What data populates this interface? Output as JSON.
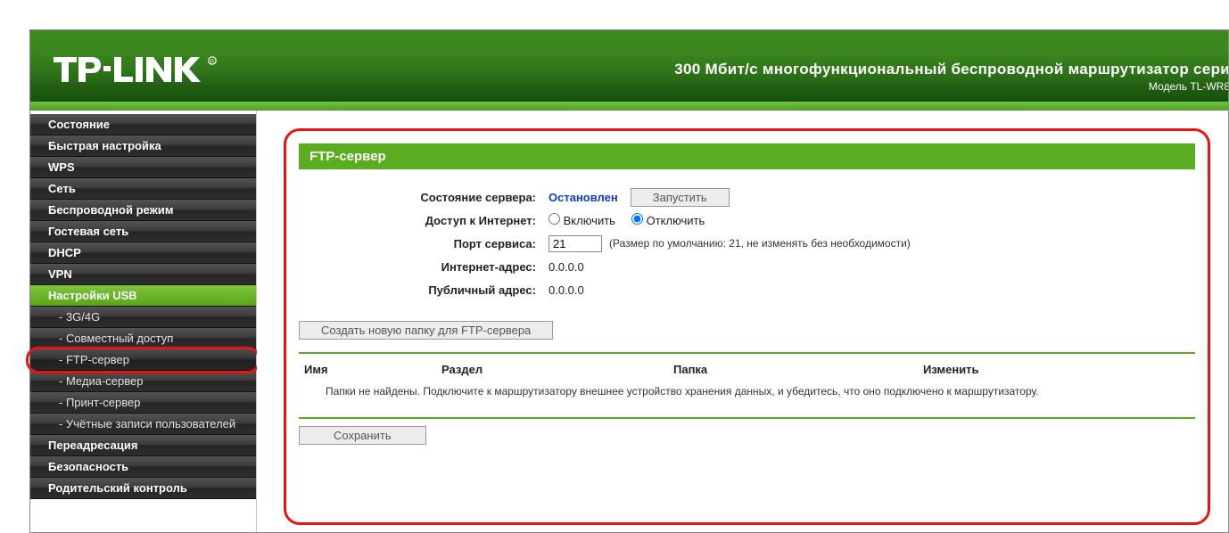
{
  "header": {
    "title": "300 Мбит/с многофункциональный беспроводной маршрутизатор сери",
    "subtitle": "Модель TL-WR8"
  },
  "sidebar": {
    "items": [
      {
        "label": "Состояние",
        "type": "top"
      },
      {
        "label": "Быстрая настройка",
        "type": "top"
      },
      {
        "label": "WPS",
        "type": "top"
      },
      {
        "label": "Сеть",
        "type": "top"
      },
      {
        "label": "Беспроводной режим",
        "type": "top"
      },
      {
        "label": "Гостевая сеть",
        "type": "top"
      },
      {
        "label": "DHCP",
        "type": "top"
      },
      {
        "label": "VPN",
        "type": "top"
      },
      {
        "label": "Настройки USB",
        "type": "top",
        "activeGroup": true
      },
      {
        "label": "- 3G/4G",
        "type": "sub"
      },
      {
        "label": "- Совместный доступ",
        "type": "sub"
      },
      {
        "label": "- FTP-сервер",
        "type": "sub",
        "activeSub": true,
        "highlight": true
      },
      {
        "label": "- Медиа-сервер",
        "type": "sub"
      },
      {
        "label": "- Принт-сервер",
        "type": "sub"
      },
      {
        "label": "- Учётные записи пользователей",
        "type": "sub"
      },
      {
        "label": "Переадресация",
        "type": "top"
      },
      {
        "label": "Безопасность",
        "type": "top"
      },
      {
        "label": "Родительский контроль",
        "type": "top"
      }
    ]
  },
  "panel": {
    "title": "FTP-сервер"
  },
  "form": {
    "server_status_label": "Состояние сервера:",
    "server_status_value": "Остановлен",
    "start_button": "Запустить",
    "internet_access_label": "Доступ к Интернет:",
    "radio_enable": "Включить",
    "radio_disable": "Отключить",
    "radio_selected": "disable",
    "service_port_label": "Порт сервиса:",
    "service_port_value": "21",
    "service_port_hint": "(Размер по умолчанию: 21, не изменять без необходимости)",
    "internet_addr_label": "Интернет-адрес:",
    "internet_addr_value": "0.0.0.0",
    "public_addr_label": "Публичный адрес:",
    "public_addr_value": "0.0.0.0",
    "new_folder_button": "Создать новую папку для FTP-сервера"
  },
  "table": {
    "col_name": "Имя",
    "col_part": "Раздел",
    "col_folder": "Папка",
    "col_change": "Изменить",
    "empty_msg": "Папки не найдены. Подключите к маршрутизатору внешнее устройство хранения данных, и убедитесь, что оно подключено к маршрутизатору."
  },
  "footer": {
    "save_button": "Сохранить"
  }
}
